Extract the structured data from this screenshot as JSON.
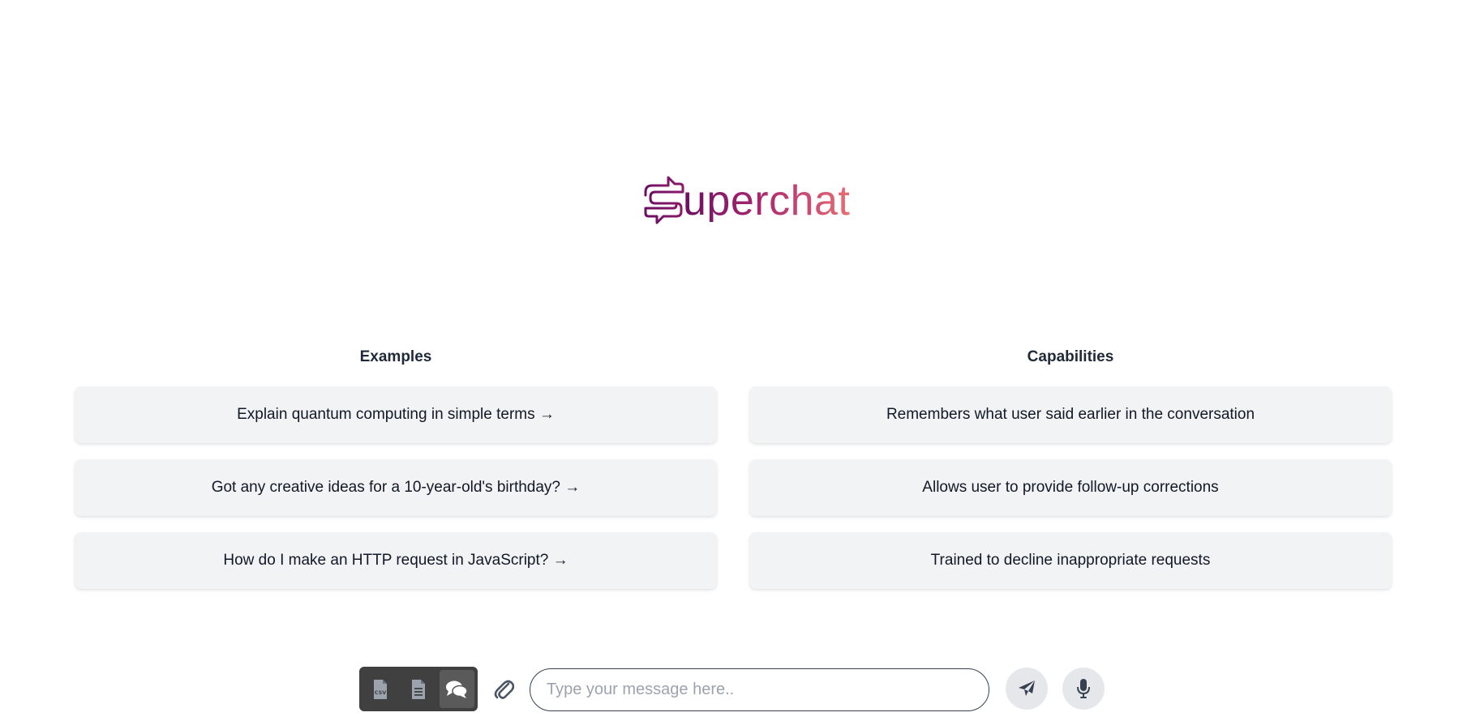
{
  "app": {
    "logo_text": "uperchat",
    "logo_icon": "speech-bubble-s-icon",
    "logo_gradient": [
      "#6b0f63",
      "#a8266f",
      "#e86c73"
    ]
  },
  "examples": {
    "heading": "Examples",
    "items": [
      "Explain quantum computing in simple terms →",
      "Got any creative ideas for a 10-year-old's birthday? →",
      "How do I make an HTTP request in JavaScript? →"
    ]
  },
  "capabilities": {
    "heading": "Capabilities",
    "items": [
      "Remembers what user said earlier in the conversation",
      "Allows user to provide follow-up corrections",
      "Trained to decline inappropriate requests"
    ]
  },
  "composer": {
    "modes": [
      {
        "icon": "csv-file-icon",
        "active": false
      },
      {
        "icon": "document-icon",
        "active": false
      },
      {
        "icon": "chat-bubbles-icon",
        "active": true
      }
    ],
    "attach_icon": "paperclip-icon",
    "placeholder": "Type your message here..",
    "value": "",
    "send_icon": "paper-plane-icon",
    "mic_icon": "microphone-icon"
  },
  "colors": {
    "toolbar_bg": "#404040",
    "card_bg": "#f2f3f5",
    "round_button_bg": "#e5e7eb"
  }
}
